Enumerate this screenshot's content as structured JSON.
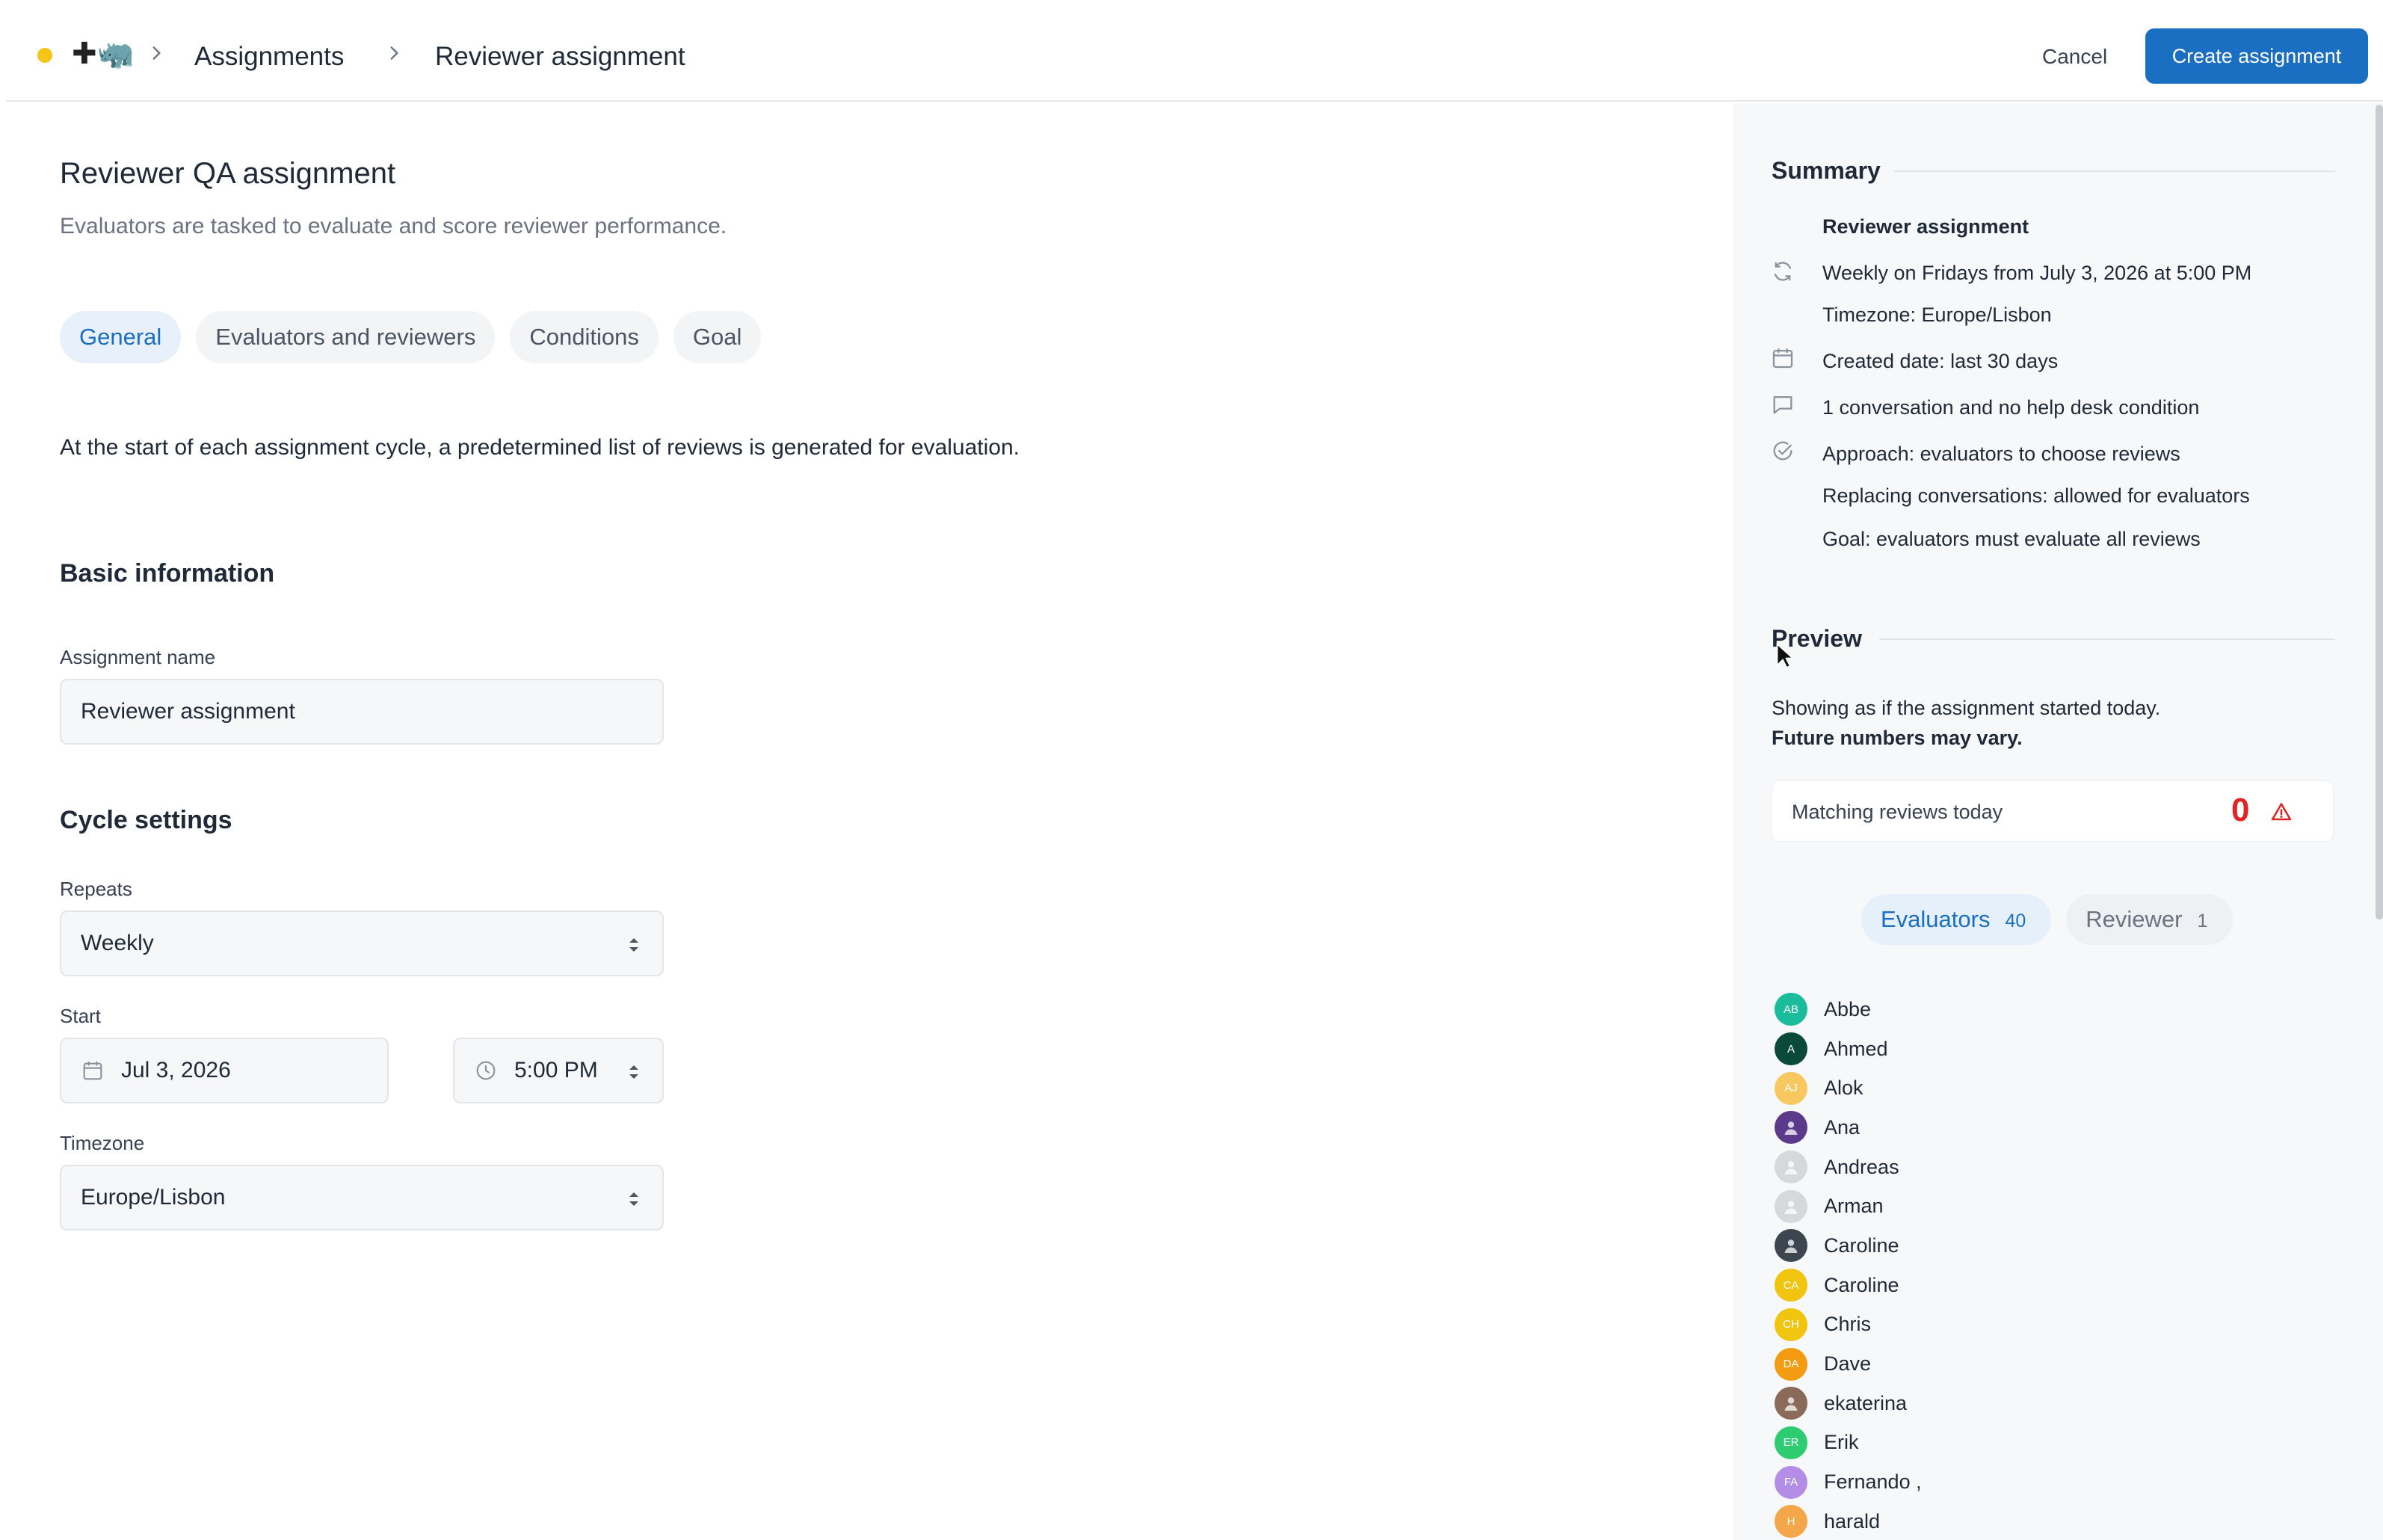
{
  "topbar": {
    "logo_glyph": "✚🦏",
    "breadcrumb": [
      "Assignments",
      "Reviewer assignment"
    ],
    "cancel_label": "Cancel",
    "create_label": "Create assignment"
  },
  "main": {
    "title": "Reviewer QA assignment",
    "subtitle": "Evaluators are tasked to evaluate and score reviewer performance.",
    "tabs": [
      {
        "label": "General",
        "active": true
      },
      {
        "label": "Evaluators and reviewers",
        "active": false
      },
      {
        "label": "Conditions",
        "active": false
      },
      {
        "label": "Goal",
        "active": false
      }
    ],
    "intro": "At the start of each assignment cycle, a predetermined list of reviews is generated for evaluation.",
    "basic_heading": "Basic information",
    "name_label": "Assignment name",
    "name_value": "Reviewer assignment",
    "cycle_heading": "Cycle settings",
    "repeats_label": "Repeats",
    "repeats_value": "Weekly",
    "start_label": "Start",
    "start_date": "Jul 3, 2026",
    "start_time": "5:00 PM",
    "timezone_label": "Timezone",
    "timezone_value": "Europe/Lisbon"
  },
  "summary": {
    "heading": "Summary",
    "name": "Reviewer assignment",
    "schedule": "Weekly on Fridays from July 3, 2026 at 5:00 PM",
    "timezone": "Timezone: Europe/Lisbon",
    "created": "Created date: last 30 days",
    "conversation": "1 conversation and no help desk condition",
    "approach": "Approach: evaluators to choose reviews",
    "replacing": "Replacing conversations: allowed for evaluators",
    "goal": "Goal: evaluators must evaluate all reviews"
  },
  "preview": {
    "heading": "Preview",
    "line1": "Showing as if the assignment started today.",
    "line2": "Future numbers may vary.",
    "matching_label": "Matching reviews today",
    "matching_value": "0",
    "evaluators_tab": "Evaluators",
    "evaluators_count": "40",
    "reviewer_tab": "Reviewer",
    "reviewer_count": "1",
    "people": [
      {
        "name": "Abbe",
        "initials": "AB",
        "color": "#1abc9c"
      },
      {
        "name": "Ahmed",
        "initials": "A",
        "color": "#0b4a3a"
      },
      {
        "name": "Alok",
        "initials": "AJ",
        "color": "#f6c85f"
      },
      {
        "name": "Ana",
        "initials": "",
        "color": "#5b3a8c"
      },
      {
        "name": "Andreas",
        "initials": "",
        "color": "#d6d8db"
      },
      {
        "name": "Arman",
        "initials": "",
        "color": "#d6d8db"
      },
      {
        "name": "Caroline",
        "initials": "",
        "color": "#3d4650"
      },
      {
        "name": "Caroline",
        "initials": "CA",
        "color": "#f1c40f"
      },
      {
        "name": "Chris",
        "initials": "CH",
        "color": "#f1c40f"
      },
      {
        "name": "Dave",
        "initials": "DA",
        "color": "#f39c12"
      },
      {
        "name": "ekaterina",
        "initials": "",
        "color": "#8a6b5a"
      },
      {
        "name": "Erik",
        "initials": "ER",
        "color": "#2ecc71"
      },
      {
        "name": "Fernando ,",
        "initials": "FA",
        "color": "#b48ee6"
      },
      {
        "name": "harald",
        "initials": "H",
        "color": "#f4a64b"
      }
    ]
  }
}
